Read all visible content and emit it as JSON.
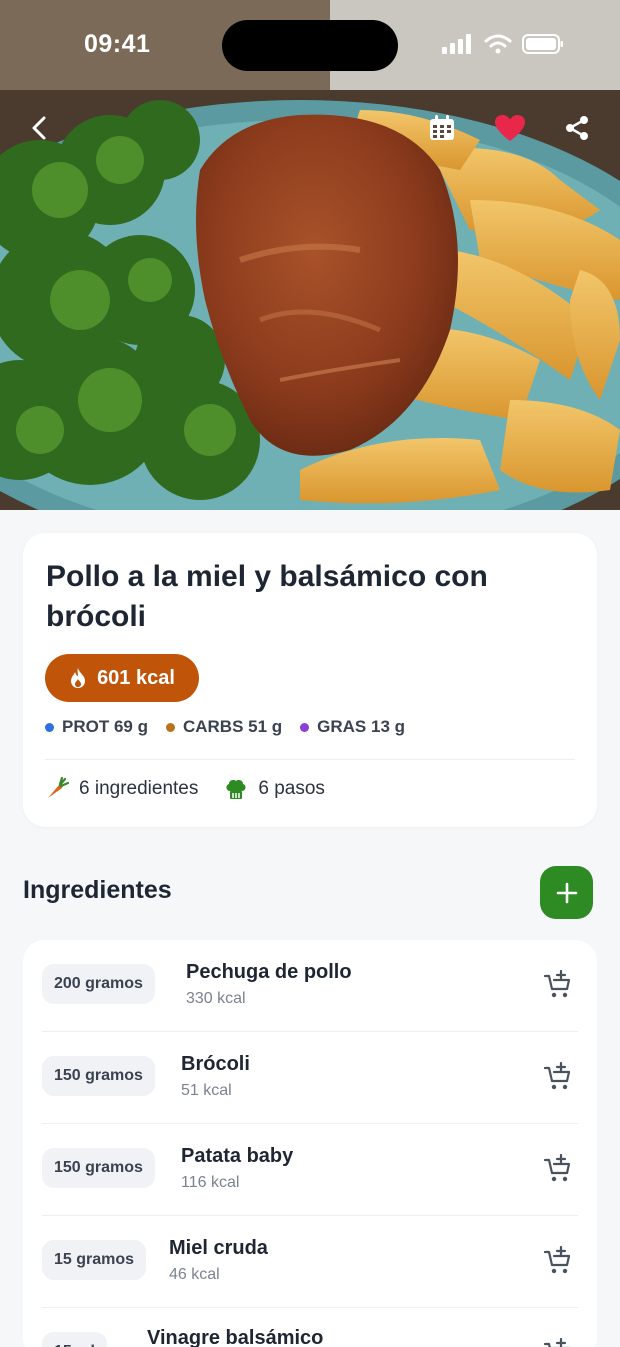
{
  "status_bar": {
    "time": "09:41"
  },
  "recipe": {
    "title": "Pollo a la miel y balsámico con brócoli",
    "kcal": "601 kcal",
    "macros": [
      {
        "label": "PROT 69 g",
        "color": "#2f6fe0"
      },
      {
        "label": "CARBS 51 g",
        "color": "#b8731a"
      },
      {
        "label": "GRAS 13 g",
        "color": "#8b3fd9"
      }
    ],
    "ingredients_count": "6 ingredientes",
    "steps_count": "6 pasos"
  },
  "ingredients_section": {
    "title": "Ingredientes",
    "items": [
      {
        "qty": "200 gramos",
        "name": "Pechuga de pollo",
        "kcal": "330 kcal"
      },
      {
        "qty": "150 gramos",
        "name": "Brócoli",
        "kcal": "51 kcal"
      },
      {
        "qty": "150 gramos",
        "name": "Patata baby",
        "kcal": "116 kcal"
      },
      {
        "qty": "15 gramos",
        "name": "Miel cruda",
        "kcal": "46 kcal"
      },
      {
        "qty": "15 ml",
        "name": "Vinagre balsámico",
        "kcal": ""
      }
    ]
  },
  "colors": {
    "accent_orange": "#c0550a",
    "accent_green": "#2e8a22",
    "favorite_red": "#e8274b"
  },
  "icons": {
    "back": "chevron-left-icon",
    "calendar": "calendar-icon",
    "favorite": "heart-icon",
    "share": "share-icon",
    "kcal": "flame-icon",
    "ingredients": "carrot-icon",
    "steps": "chef-hat-icon",
    "add": "plus-icon",
    "cart": "cart-add-icon"
  }
}
